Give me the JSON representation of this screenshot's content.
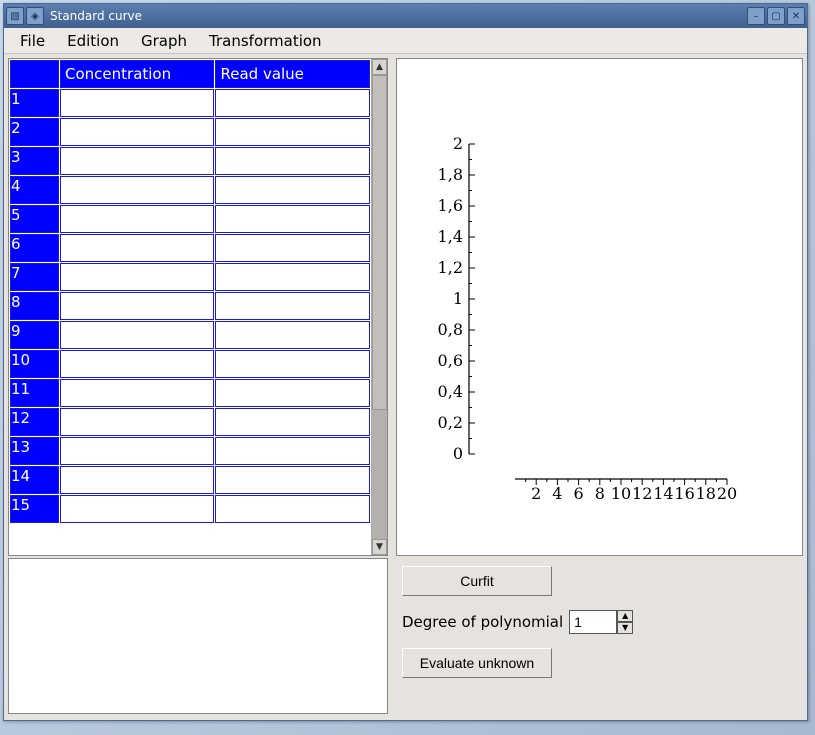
{
  "window": {
    "title": "Standard curve"
  },
  "menu": {
    "items": [
      "File",
      "Edition",
      "Graph",
      "Transformation"
    ]
  },
  "table": {
    "headers": [
      "Concentration",
      "Read value"
    ],
    "row_count": 15,
    "row_numbers": [
      "1",
      "2",
      "3",
      "4",
      "5",
      "6",
      "7",
      "8",
      "9",
      "10",
      "11",
      "12",
      "13",
      "14",
      "15"
    ],
    "cells": [
      [
        "",
        ""
      ],
      [
        "",
        ""
      ],
      [
        "",
        ""
      ],
      [
        "",
        ""
      ],
      [
        "",
        ""
      ],
      [
        "",
        ""
      ],
      [
        "",
        ""
      ],
      [
        "",
        ""
      ],
      [
        "",
        ""
      ],
      [
        "",
        ""
      ],
      [
        "",
        ""
      ],
      [
        "",
        ""
      ],
      [
        "",
        ""
      ],
      [
        "",
        ""
      ],
      [
        "",
        ""
      ]
    ]
  },
  "buttons": {
    "curfit": "Curfit",
    "evaluate": "Evaluate unknown"
  },
  "degree": {
    "label": "Degree of polynomial",
    "value": "1"
  },
  "chart_data": {
    "type": "scatter",
    "title": "",
    "xlabel": "",
    "ylabel": "",
    "series": [],
    "xlim": [
      0,
      20
    ],
    "ylim": [
      0,
      2
    ],
    "x_ticks": [
      2,
      4,
      6,
      8,
      10,
      12,
      14,
      16,
      18,
      20
    ],
    "y_ticks_labels": [
      "0",
      "0,2",
      "0,4",
      "0,6",
      "0,8",
      "1",
      "1,2",
      "1,4",
      "1,6",
      "1,8",
      "2"
    ],
    "y_ticks_values": [
      0,
      0.2,
      0.4,
      0.6,
      0.8,
      1,
      1.2,
      1.4,
      1.6,
      1.8,
      2
    ]
  }
}
